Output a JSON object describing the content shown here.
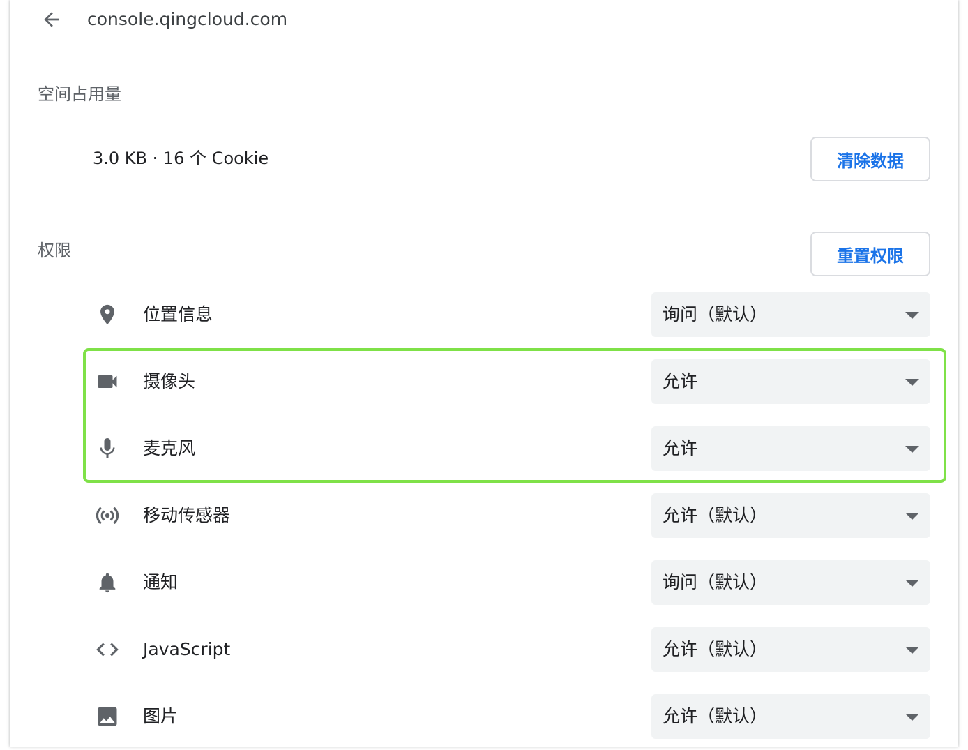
{
  "header": {
    "back_icon": "arrow-back-icon",
    "site": "console.qingcloud.com"
  },
  "usage": {
    "title": "空间占用量",
    "summary": "3.0 KB · 16 个 Cookie",
    "clear_button": "清除数据"
  },
  "permissions": {
    "title": "权限",
    "reset_button": "重置权限",
    "items": [
      {
        "icon": "location-pin-icon",
        "label": "位置信息",
        "value": "询问（默认）"
      },
      {
        "icon": "camera-icon",
        "label": "摄像头",
        "value": "允许"
      },
      {
        "icon": "microphone-icon",
        "label": "麦克风",
        "value": "允许"
      },
      {
        "icon": "sensors-icon",
        "label": "移动传感器",
        "value": "允许（默认）"
      },
      {
        "icon": "bell-icon",
        "label": "通知",
        "value": "询问（默认）"
      },
      {
        "icon": "code-icon",
        "label": "JavaScript",
        "value": "允许（默认）"
      },
      {
        "icon": "image-icon",
        "label": "图片",
        "value": "允许（默认）"
      }
    ]
  },
  "colors": {
    "accent": "#1a73e8",
    "highlight": "#7fe148",
    "select_bg": "#f1f3f4",
    "icon": "#5f6368"
  }
}
